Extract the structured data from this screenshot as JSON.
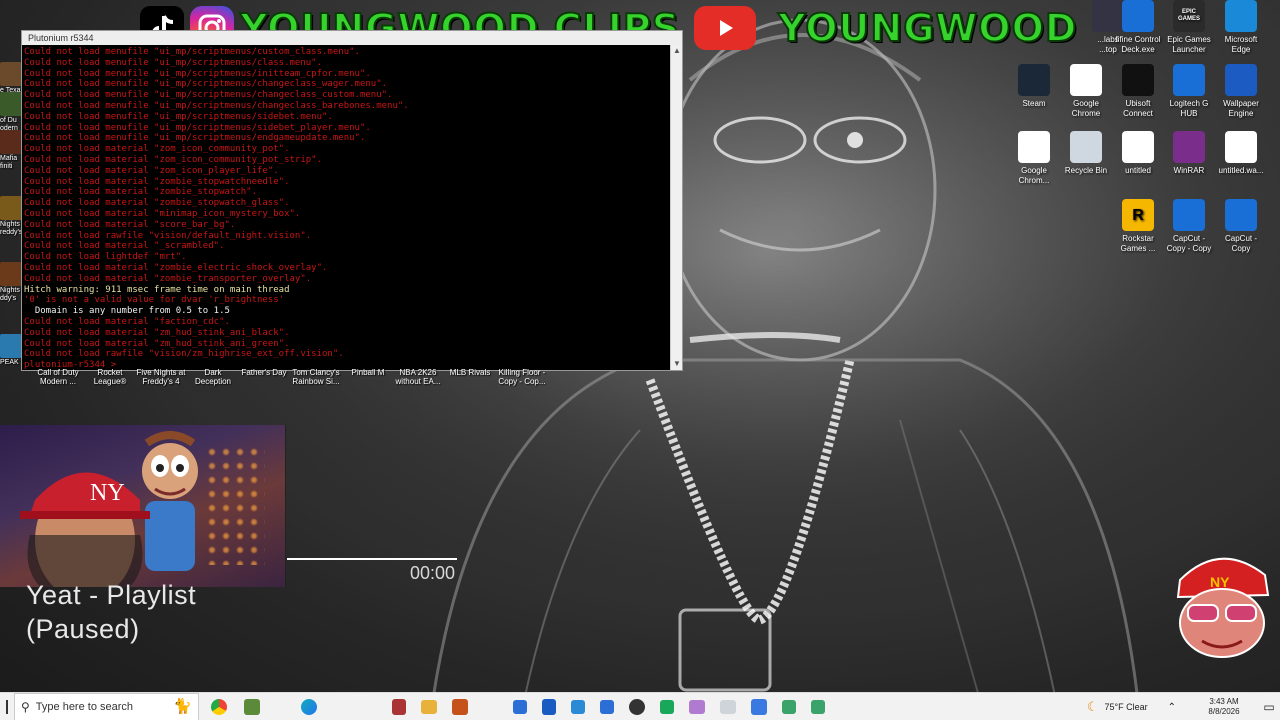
{
  "banner": {
    "left_channel": "YOUNGWOOD CLIPS",
    "right_channel": "YOUNGWOOD"
  },
  "console": {
    "title": "Plutonium r5344",
    "lines": [
      {
        "t": "Could not load menufile \"ui_mp/scriptmenus/custom_class.menu\".",
        "c": "red"
      },
      {
        "t": "Could not load menufile \"ui_mp/scriptmenus/class.menu\".",
        "c": "red"
      },
      {
        "t": "Could not load menufile \"ui_mp/scriptmenus/initteam_cpfor.menu\".",
        "c": "red"
      },
      {
        "t": "Could not load menufile \"ui_mp/scriptmenus/changeclass_wager.menu\".",
        "c": "red"
      },
      {
        "t": "Could not load menufile \"ui_mp/scriptmenus/changeclass_custom.menu\".",
        "c": "red"
      },
      {
        "t": "Could not load menufile \"ui_mp/scriptmenus/changeclass_barebones.menu\".",
        "c": "red"
      },
      {
        "t": "Could not load menufile \"ui_mp/scriptmenus/sidebet.menu\".",
        "c": "red"
      },
      {
        "t": "Could not load menufile \"ui_mp/scriptmenus/sidebet_player.menu\".",
        "c": "red"
      },
      {
        "t": "Could not load menufile \"ui_mp/scriptmenus/endgameupdate.menu\".",
        "c": "red"
      },
      {
        "t": "Could not load material \"zom_icon_community_pot\".",
        "c": "red"
      },
      {
        "t": "Could not load material \"zom_icon_community_pot_strip\".",
        "c": "red"
      },
      {
        "t": "Could not load material \"zom_icon_player_life\".",
        "c": "red"
      },
      {
        "t": "Could not load material \"zombie_stopwatchneedle\".",
        "c": "red"
      },
      {
        "t": "Could not load material \"zombie_stopwatch\".",
        "c": "red"
      },
      {
        "t": "Could not load material \"zombie_stopwatch_glass\".",
        "c": "red"
      },
      {
        "t": "Could not load material \"minimap_icon_mystery_box\".",
        "c": "red"
      },
      {
        "t": "Could not load material \"score_bar_bg\".",
        "c": "red"
      },
      {
        "t": "Could not load rawfile \"vision/default_night.vision\".",
        "c": "red"
      },
      {
        "t": "Could not load material \"_scrambled\".",
        "c": "red"
      },
      {
        "t": "Could not load lightdef \"mrt\".",
        "c": "red"
      },
      {
        "t": "Could not load material \"zombie_electric_shock_overlay\".",
        "c": "red"
      },
      {
        "t": "Could not load material \"zombie_transporter_overlay\".",
        "c": "red"
      },
      {
        "t": "Hitch warning: 911 msec frame time on main thread",
        "c": "yellow"
      },
      {
        "t": "'0' is not a valid value for dvar 'r_brightness'",
        "c": "red"
      },
      {
        "t": "  Domain is any number from 0.5 to 1.5",
        "c": "white"
      },
      {
        "t": "Could not load material \"faction_cdc\".",
        "c": "red"
      },
      {
        "t": "Could not load material \"zm_hud_stink_ani_black\".",
        "c": "red"
      },
      {
        "t": "Could not load material \"zm_hud_stink_ani_green\".",
        "c": "red"
      },
      {
        "t": "Could not load rawfile \"vision/zm_highrise_ext_off.vision\".",
        "c": "red"
      },
      {
        "t": "plutonium-r5344 >",
        "c": "red"
      }
    ]
  },
  "left_icons": [
    {
      "label": "e Texas\nain Sa",
      "color": "#6a4a2a"
    },
    {
      "label": "of Du\nodern",
      "color": "#3a5a2a"
    },
    {
      "label": "Mafia\nfiniti",
      "color": "#5a2a1a"
    },
    {
      "label": "Nights\nreddy's",
      "color": "#7a5a1a"
    },
    {
      "label": "Nights\nddy's",
      "color": "#6a3a1a"
    },
    {
      "label": "PEAK",
      "color": "#2a7ab0"
    }
  ],
  "desktop_row": [
    {
      "label": "Call of Duty\nModern ..."
    },
    {
      "label": "Rocket\nLeague®"
    },
    {
      "label": "Five Nights at\nFreddy's 4"
    },
    {
      "label": "Dark\nDeception"
    },
    {
      "label": "Father's Day"
    },
    {
      "label": "Tom Clancy's\nRainbow Si..."
    },
    {
      "label": "Pinball M"
    },
    {
      "label": "NBA 2K26\nwithout EA..."
    },
    {
      "label": "MLB Rivals"
    },
    {
      "label": "Killing Floor -\nCopy - Cop..."
    }
  ],
  "right_icons": {
    "row1": [
      {
        "label": "...labs\n...top",
        "color": "#334"
      },
      {
        "label": "fifine Control\nDeck.exe",
        "color": "#1a6fd6"
      },
      {
        "label": "Epic Games\nLauncher",
        "color": "#2b2b2b",
        "glyph": "EPIC\nGAMES"
      },
      {
        "label": "Microsoft\nEdge",
        "color": "#1a8ad8"
      }
    ],
    "row2": [
      {
        "label": "Steam",
        "color": "#1b2838"
      },
      {
        "label": "Google\nChrome",
        "color": "#ffffff"
      },
      {
        "label": "Ubisoft\nConnect",
        "color": "#111"
      },
      {
        "label": "Logitech G\nHUB",
        "color": "#1a6fd6"
      },
      {
        "label": "Wallpaper\nEngine",
        "color": "#1b5bc2"
      }
    ],
    "row3": [
      {
        "label": "Google\nChrom...",
        "color": "#ffffff"
      },
      {
        "label": "Recycle Bin",
        "color": "#cfd8e0"
      },
      {
        "label": "untitled",
        "color": "#ffffff"
      },
      {
        "label": "WinRAR",
        "color": "#7a2d8a"
      },
      {
        "label": "untitled.wa...",
        "color": "#ffffff"
      }
    ],
    "row4": [
      {
        "label": "Rockstar\nGames ...",
        "color": "#f5b700",
        "glyph": "R"
      },
      {
        "label": "CapCut -\nCopy - Copy",
        "color": "#1a6fd6"
      },
      {
        "label": "CapCut -\nCopy",
        "color": "#1a6fd6"
      }
    ]
  },
  "playlist": {
    "title": "Yeat - Playlist",
    "status": "(Paused)",
    "time": "00:00"
  },
  "taskbar": {
    "search_placeholder": "Type here to search",
    "weather": "75°F  Clear",
    "time": "3:43 AM",
    "date": "8/8/2026"
  }
}
